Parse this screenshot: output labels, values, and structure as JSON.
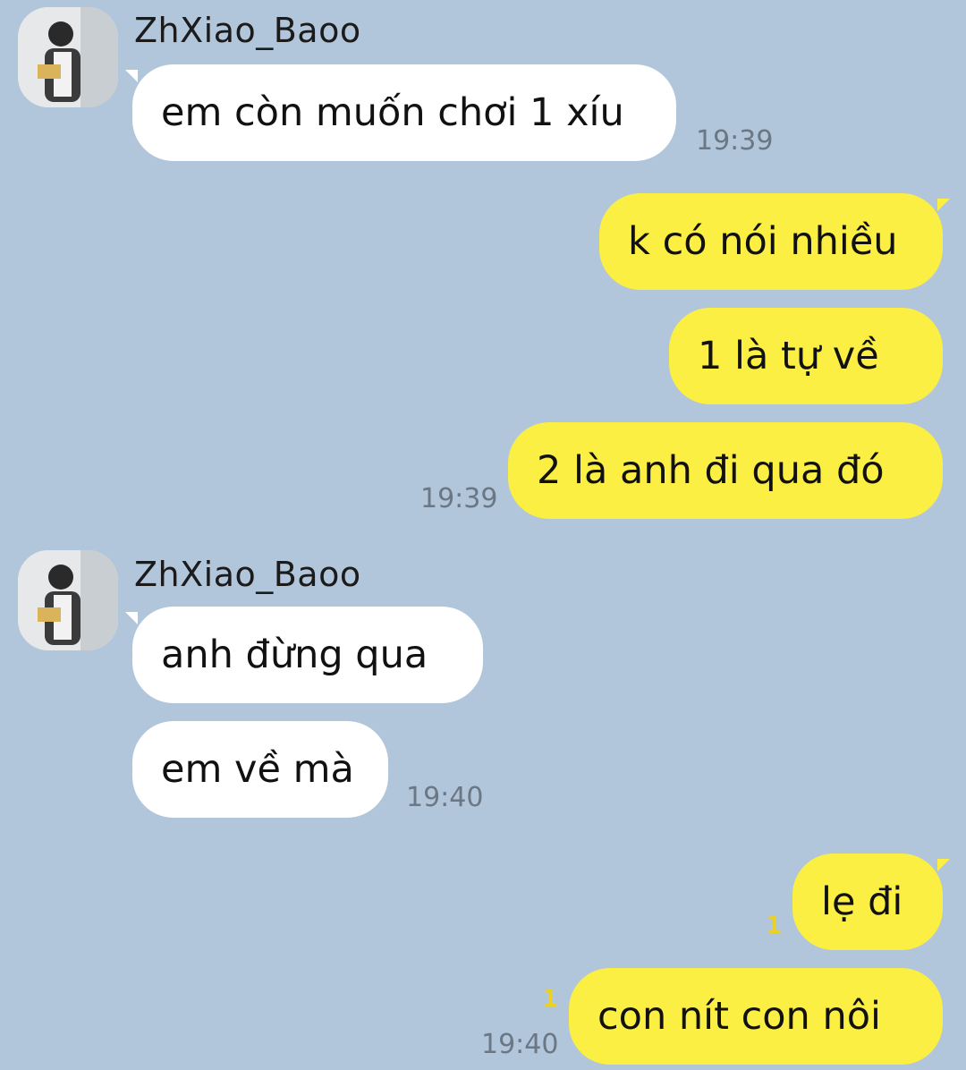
{
  "colors": {
    "background": "#b1c6da",
    "incoming_bubble": "#ffffff",
    "outgoing_bubble": "#fcef43",
    "timestamp": "#6b7784",
    "unread_count": "#e9d12a"
  },
  "groups": [
    {
      "direction": "incoming",
      "sender": "ZhXiao_Baoo",
      "avatar": "profile-photo",
      "messages": [
        "em còn muốn chơi 1 xíu"
      ],
      "time": "19:39"
    },
    {
      "direction": "outgoing",
      "messages": [
        "k có nói nhiều",
        "1 là tự về",
        "2 là anh đi qua đó"
      ],
      "time": "19:39"
    },
    {
      "direction": "incoming",
      "sender": "ZhXiao_Baoo",
      "avatar": "profile-photo",
      "messages": [
        "anh đừng qua",
        "em về mà"
      ],
      "time": "19:40"
    },
    {
      "direction": "outgoing",
      "messages": [
        "lẹ đi",
        "con nít con nôi"
      ],
      "unread": [
        "1",
        "1"
      ],
      "time": "19:40"
    }
  ]
}
